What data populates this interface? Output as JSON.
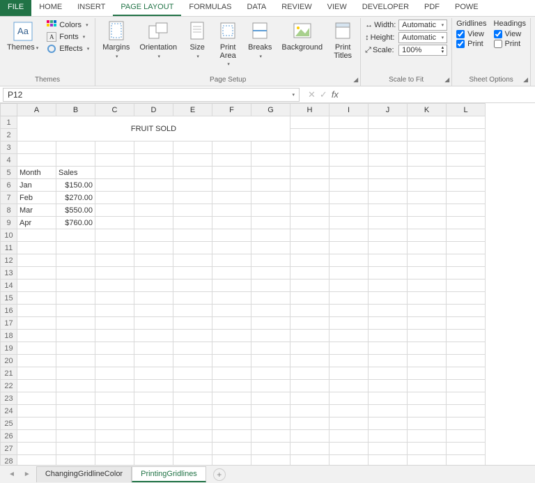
{
  "tabs": {
    "file": "FILE",
    "list": [
      "HOME",
      "INSERT",
      "PAGE LAYOUT",
      "FORMULAS",
      "DATA",
      "REVIEW",
      "VIEW",
      "DEVELOPER",
      "PDF",
      "POWE"
    ],
    "active": "PAGE LAYOUT"
  },
  "ribbon": {
    "themes": {
      "label": "Themes",
      "btn": "Themes",
      "colors": "Colors",
      "fonts": "Fonts",
      "effects": "Effects"
    },
    "pagesetup": {
      "label": "Page Setup",
      "margins": "Margins",
      "orientation": "Orientation",
      "size": "Size",
      "printarea": "Print\nArea",
      "breaks": "Breaks",
      "background": "Background",
      "printtitles": "Print\nTitles"
    },
    "scale": {
      "label": "Scale to Fit",
      "width": "Width:",
      "widthv": "Automatic",
      "height": "Height:",
      "heightv": "Automatic",
      "scale": "Scale:",
      "scalev": "100%"
    },
    "sheetopt": {
      "label": "Sheet Options",
      "gridlines": "Gridlines",
      "headings": "Headings",
      "view": "View",
      "print": "Print",
      "gridlines_view": true,
      "gridlines_print": true,
      "headings_view": true,
      "headings_print": false
    }
  },
  "namebox": "P12",
  "formula": "",
  "columns": [
    "A",
    "B",
    "C",
    "D",
    "E",
    "F",
    "G",
    "H",
    "I",
    "J",
    "K",
    "L"
  ],
  "rowcount": 28,
  "title_cell": "FRUIT SOLD",
  "data": {
    "headers": [
      "Month",
      "Sales"
    ],
    "rows": [
      [
        "Jan",
        "$150.00"
      ],
      [
        "Feb",
        "$270.00"
      ],
      [
        "Mar",
        "$550.00"
      ],
      [
        "Apr",
        "$760.00"
      ]
    ]
  },
  "sheets": {
    "list": [
      "ChangingGridlineColor",
      "PrintingGridlines"
    ],
    "active": "PrintingGridlines"
  }
}
